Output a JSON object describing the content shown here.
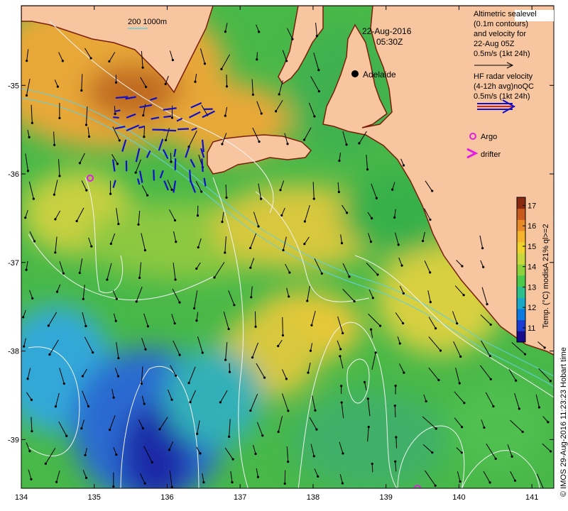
{
  "map": {
    "date": "22-Aug-2016",
    "time": "05:30Z",
    "city": "Adelaide",
    "scale_bar": "200  1000m",
    "x_ticks": [
      "134",
      "135",
      "136",
      "137",
      "138",
      "139",
      "140",
      "141"
    ],
    "y_ticks": [
      "-35",
      "-36",
      "-37",
      "-38",
      "-39"
    ],
    "x_tick_values": [
      134,
      135,
      136,
      137,
      138,
      139,
      140,
      141
    ],
    "y_tick_values": [
      -35,
      -36,
      -37,
      -38,
      -39
    ],
    "lon_range": [
      134,
      141.3
    ],
    "lat_range": [
      -39.55,
      -34.1
    ]
  },
  "legend": {
    "altimetric_lines": [
      "Altimetric sealevel",
      "(0.1m contours)",
      "and velocity for",
      "22-Aug 05Z",
      "0.5m/s (1kt 24h)"
    ],
    "hf_lines": [
      "HF radar velocity",
      "(4-12h avg)noQC",
      "0.5m/s (1kt 24h)"
    ],
    "argo": "Argo",
    "drifter": "drifter"
  },
  "colorbar": {
    "title": "Temp. (°C) modisA 21% ql>=2",
    "ticks": [
      "11",
      "12",
      "13",
      "14",
      "15",
      "16",
      "17"
    ],
    "range": [
      10.3,
      17.4
    ],
    "colors": [
      "#1a0a8c",
      "#1a3cd0",
      "#0a7ae0",
      "#1aa8c8",
      "#2cc08c",
      "#4cc84c",
      "#8cd23c",
      "#c8d83c",
      "#f0d22c",
      "#f5b42c",
      "#e88a28",
      "#c85a1e",
      "#8a2a10"
    ]
  },
  "footer": "© IMOS 29-Aug-2016 11:23:23 Hobart time",
  "colors": {
    "land": "#f7c59f",
    "coast": "#7a1e0a",
    "sst_warm": "#e0a83a",
    "sst_mid": "#4cbc4a",
    "sst_cool": "#2aa8d8",
    "sst_cold": "#1f3cc8",
    "hf_arrow": "#1010c8",
    "argo": "#e020e0"
  }
}
